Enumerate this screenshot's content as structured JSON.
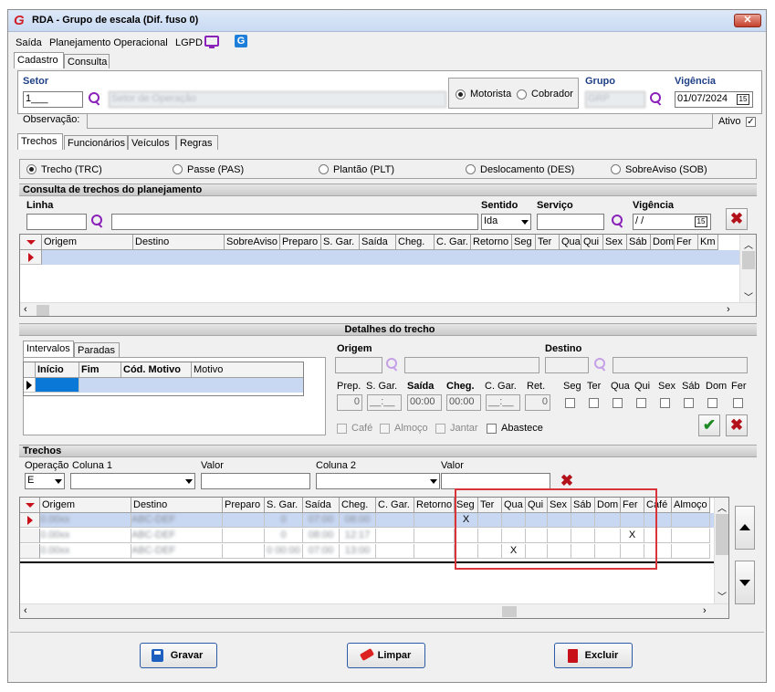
{
  "window": {
    "title": "RDA - Grupo de escala (Dif. fuso 0)",
    "close": "✕"
  },
  "menu": {
    "items": [
      "Saída",
      "Planejamento Operacional",
      "LGPD"
    ]
  },
  "main_tabs": [
    "Cadastro",
    "Consulta"
  ],
  "setor": {
    "label": "Setor",
    "code": "1___",
    "name": "Setor de Operação"
  },
  "tipo": {
    "motorista": "Motorista",
    "cobrador": "Cobrador"
  },
  "grupo": {
    "label": "Grupo",
    "value": "GRP"
  },
  "vigencia": {
    "label": "Vigência",
    "value": "01/07/2024",
    "cal": "15"
  },
  "observacao": {
    "label": "Observação:"
  },
  "ativo": {
    "label": "Ativo",
    "check": "✓"
  },
  "sub_tabs": [
    "Trechos",
    "Funcionários",
    "Veículos",
    "Regras"
  ],
  "trecho_types": [
    "Trecho (TRC)",
    "Passe (PAS)",
    "Plantão (PLT)",
    "Deslocamento (DES)",
    "SobreAviso (SOB)"
  ],
  "consulta": {
    "title": "Consulta de trechos do planejamento",
    "linha": "Linha",
    "sentido": "Sentido",
    "sentido_value": "Ida",
    "servico": "Serviço",
    "vigencia": "Vigência",
    "vigencia_value": " / /",
    "cal": "15",
    "columns": [
      "Origem",
      "Destino",
      "SobreAviso",
      "Preparo",
      "S. Gar.",
      "Saída",
      "Cheg.",
      "C. Gar.",
      "Retorno",
      "Seg",
      "Ter",
      "Qua",
      "Qui",
      "Sex",
      "Sáb",
      "Dom",
      "Fer",
      "Km"
    ]
  },
  "detalhes": {
    "title": "Detalhes do trecho",
    "tabs": [
      "Intervalos",
      "Paradas"
    ],
    "int_columns": [
      "Início",
      "Fim",
      "Cód. Motivo",
      "Motivo"
    ],
    "origem": "Origem",
    "destino": "Destino",
    "fields": {
      "prep": "Prep.",
      "sgar": "S. Gar.",
      "saida": "Saída",
      "cheg": "Cheg.",
      "cgar": "C. Gar.",
      "ret": "Ret."
    },
    "values": {
      "prep": "0",
      "sgar": "__:__",
      "saida": "00:00",
      "cheg": "00:00",
      "cgar": "__:__",
      "ret": "0"
    },
    "days": [
      "Seg",
      "Ter",
      "Qua",
      "Qui",
      "Sex",
      "Sáb",
      "Dom",
      "Fer"
    ],
    "extras": [
      "Café",
      "Almoço",
      "Jantar",
      "Abastece"
    ]
  },
  "trechos": {
    "title": "Trechos",
    "operacao": "Operação",
    "operacao_value": "E",
    "coluna1": "Coluna 1",
    "valor1": "Valor",
    "coluna2": "Coluna 2",
    "valor2": "Valor",
    "columns": [
      "Origem",
      "Destino",
      "Preparo",
      "S. Gar.",
      "Saída",
      "Cheg.",
      "C. Gar.",
      "Retorno",
      "Seg",
      "Ter",
      "Qua",
      "Qui",
      "Sex",
      "Sáb",
      "Dom",
      "Fer",
      "Café",
      "Almoço"
    ],
    "rows": [
      {
        "origem": "0.00xx",
        "destino": "ABC-DEF",
        "preparo": "",
        "sgar": "0",
        "saida": "07:00",
        "cheg": "08:00",
        "cgar": "",
        "retorno": "",
        "marks": [
          "X",
          "",
          "",
          "",
          "",
          "",
          "",
          ""
        ]
      },
      {
        "origem": "0.00xx",
        "destino": "ABC-DEF",
        "preparo": "",
        "sgar": "0",
        "saida": "08:00",
        "cheg": "12:17",
        "cgar": "",
        "retorno": "",
        "marks": [
          "",
          "",
          "",
          "",
          "",
          "",
          "",
          "X"
        ]
      },
      {
        "origem": "0.00xx",
        "destino": "ABC-DEF",
        "preparo": "",
        "sgar": "0 00:00",
        "saida": "07:00",
        "cheg": "13:00",
        "cgar": "",
        "retorno": "",
        "marks": [
          "",
          "",
          "X",
          "",
          "",
          "",
          "",
          ""
        ]
      }
    ]
  },
  "buttons": {
    "gravar": "Gravar",
    "limpar": "Limpar",
    "excluir": "Excluir"
  },
  "colors": {
    "section_title": "#1f3f86",
    "highlight_box": "#d9343a",
    "row_select": "#c8d7f2"
  }
}
